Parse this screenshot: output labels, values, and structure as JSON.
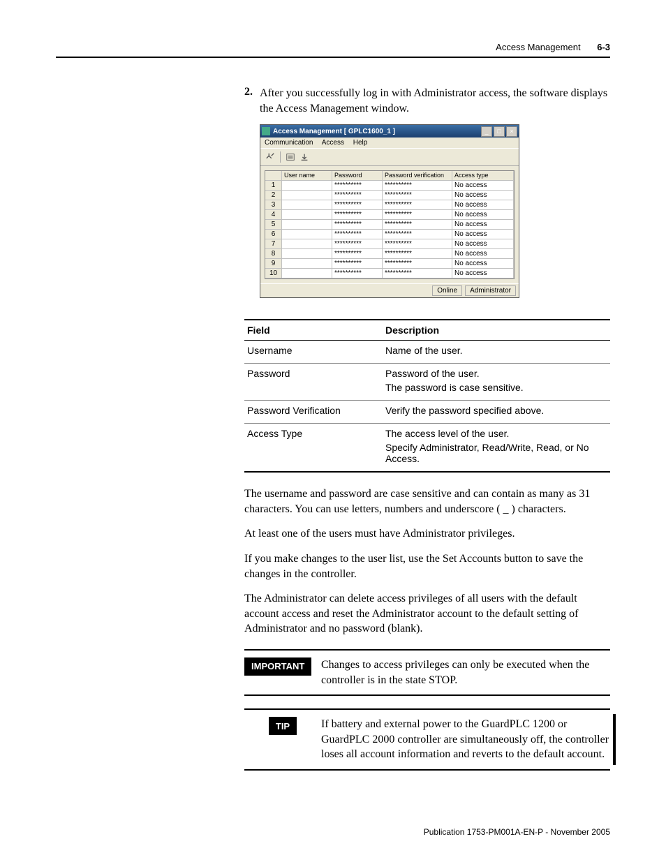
{
  "header": {
    "section": "Access Management",
    "page": "6-3"
  },
  "step": {
    "num": "2.",
    "text": "After you successfully log in with Administrator access, the software displays the Access Management window."
  },
  "shot": {
    "title": "Access Management [ GPLC1600_1 ]",
    "menus": {
      "m1": "Communication",
      "m2": "Access",
      "m3": "Help"
    },
    "cols": {
      "user": "User name",
      "pass": "Password",
      "ver": "Password verification",
      "acc": "Access type"
    },
    "rows": [
      {
        "n": "1",
        "user": "",
        "pass": "**********",
        "ver": "**********",
        "acc": "No access"
      },
      {
        "n": "2",
        "user": "",
        "pass": "**********",
        "ver": "**********",
        "acc": "No access"
      },
      {
        "n": "3",
        "user": "",
        "pass": "**********",
        "ver": "**********",
        "acc": "No access"
      },
      {
        "n": "4",
        "user": "",
        "pass": "**********",
        "ver": "**********",
        "acc": "No access"
      },
      {
        "n": "5",
        "user": "",
        "pass": "**********",
        "ver": "**********",
        "acc": "No access"
      },
      {
        "n": "6",
        "user": "",
        "pass": "**********",
        "ver": "**********",
        "acc": "No access"
      },
      {
        "n": "7",
        "user": "",
        "pass": "**********",
        "ver": "**********",
        "acc": "No access"
      },
      {
        "n": "8",
        "user": "",
        "pass": "**********",
        "ver": "**********",
        "acc": "No access"
      },
      {
        "n": "9",
        "user": "",
        "pass": "**********",
        "ver": "**********",
        "acc": "No access"
      },
      {
        "n": "10",
        "user": "",
        "pass": "**********",
        "ver": "**********",
        "acc": "No access"
      }
    ],
    "status": {
      "s1": "Online",
      "s2": "Administrator"
    }
  },
  "ftable": {
    "h1": "Field",
    "h2": "Description",
    "rows": [
      {
        "f": "Username",
        "d1": "Name of the user."
      },
      {
        "f": "Password",
        "d1": "Password of the user.",
        "d2": "The password is case sensitive."
      },
      {
        "f": "Password Verification",
        "d1": "Verify the password specified above."
      },
      {
        "f": "Access Type",
        "d1": "The access level of the user.",
        "d2": "Specify Administrator, Read/Write, Read, or No Access."
      }
    ]
  },
  "paras": {
    "p1": "The username and password are case sensitive and can contain as many as 31 characters. You can use letters, numbers and underscore ( _ ) characters.",
    "p2": "At least one of the users must have Administrator privileges.",
    "p3": "If you make changes to the user list, use the Set Accounts button to save the changes in the controller.",
    "p4": "The Administrator can delete access privileges of all users with the default account access and reset the Administrator account to the default setting of Administrator and no password (blank)."
  },
  "important": {
    "tag": "IMPORTANT",
    "text": "Changes to access privileges can only be executed when the controller is in the state STOP."
  },
  "tip": {
    "tag": "TIP",
    "text": "If battery and external power to the GuardPLC 1200 or GuardPLC 2000 controller are simultaneously off, the controller loses all account information and reverts to the default account."
  },
  "footer": "Publication 1753-PM001A-EN-P - November 2005"
}
